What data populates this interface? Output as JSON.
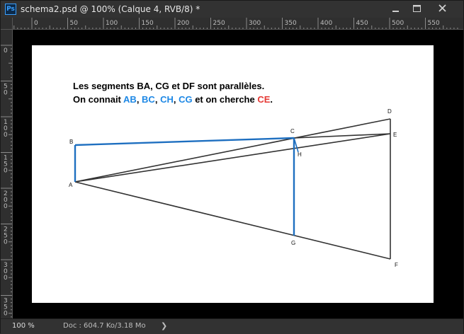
{
  "window": {
    "app_icon": "photoshop-icon",
    "app_icon_text": "Ps",
    "title": "schema2.psd @ 100% (Calque 4, RVB/8) *",
    "controls": [
      "minimize-icon",
      "maximize-icon",
      "close-icon"
    ]
  },
  "rulers": {
    "horizontal_labels": [
      "0",
      "50",
      "100",
      "150",
      "200",
      "250",
      "300",
      "350",
      "400",
      "450",
      "500",
      "550"
    ],
    "vertical_labels": [
      [
        "0"
      ],
      [
        "5",
        "0"
      ],
      [
        "1",
        "0",
        "0"
      ],
      [
        "1",
        "5",
        "0"
      ],
      [
        "2",
        "0",
        "0"
      ],
      [
        "2",
        "5",
        "0"
      ],
      [
        "3",
        "0",
        "0"
      ],
      [
        "3",
        "5",
        "0"
      ]
    ]
  },
  "document": {
    "caption_line1": "Les segments BA, CG et DF sont parallèles.",
    "caption_line2": {
      "prefix": "On connait ",
      "known": [
        "AB",
        "BC",
        "CH",
        "CG"
      ],
      "separator": ", ",
      "middle": " et on cherche ",
      "unknown": "CE",
      "suffix": "."
    },
    "points": [
      "A",
      "B",
      "C",
      "D",
      "E",
      "F",
      "G",
      "H"
    ],
    "colors": {
      "known_segments": "#1e88e5",
      "unknown_segment": "#e53935",
      "construction_lines": "#333333"
    }
  },
  "status": {
    "zoom": "100 %",
    "doc_info": "Doc : 604.7 Ko/3.18 Mo",
    "arrow": "❯"
  }
}
